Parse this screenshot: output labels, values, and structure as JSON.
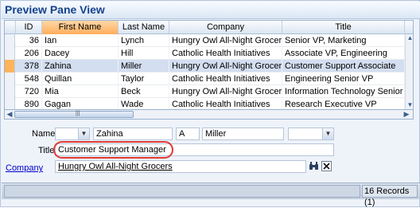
{
  "window": {
    "title": "Preview Pane View"
  },
  "grid": {
    "columns": [
      "ID",
      "First Name",
      "Last Name",
      "Company",
      "Title"
    ],
    "sorted_column": "First Name",
    "rows": [
      {
        "id": "36",
        "first": "Ian",
        "last": "Lynch",
        "company": "Hungry Owl All-Night Grocers",
        "title": "Senior VP, Marketing",
        "selected": false
      },
      {
        "id": "206",
        "first": "Dacey",
        "last": "Hill",
        "company": "Catholic Health Initiatives",
        "title": "Associate VP, Engineering",
        "selected": false
      },
      {
        "id": "378",
        "first": "Zahina",
        "last": "Miller",
        "company": "Hungry Owl All-Night Grocers",
        "title": "Customer Support Associate",
        "selected": true
      },
      {
        "id": "548",
        "first": "Quillan",
        "last": "Taylor",
        "company": "Catholic Health Initiatives",
        "title": "Engineering Senior VP",
        "selected": false
      },
      {
        "id": "720",
        "first": "Mia",
        "last": "Beck",
        "company": "Hungry Owl All-Night Grocers",
        "title": "Information Technology Senior VP",
        "selected": false
      },
      {
        "id": "890",
        "first": "Gagan",
        "last": "Wade",
        "company": "Catholic Health Initiatives",
        "title": "Research Executive VP",
        "selected": false
      }
    ]
  },
  "detail": {
    "name_label": "Name",
    "prefix_value": "",
    "first_name": "Zahina",
    "middle_initial": "A",
    "last_name": "Miller",
    "suffix_value": "",
    "title_label": "Title",
    "title_value": "Customer Support Manager",
    "company_label": "Company",
    "company_value": "Hungry Owl All-Night Grocers"
  },
  "status": {
    "records": "16 Records (1)"
  },
  "colors": {
    "accent_sorted": "#ffae5c",
    "selection": "#d3def0",
    "highlight_ring": "#e23a34",
    "link": "#0000cc"
  },
  "icons": [
    "dropdown-arrow-icon",
    "binoculars-icon",
    "clear-x-icon",
    "scroll-up-icon",
    "scroll-down-icon",
    "scroll-left-icon",
    "scroll-right-icon"
  ]
}
